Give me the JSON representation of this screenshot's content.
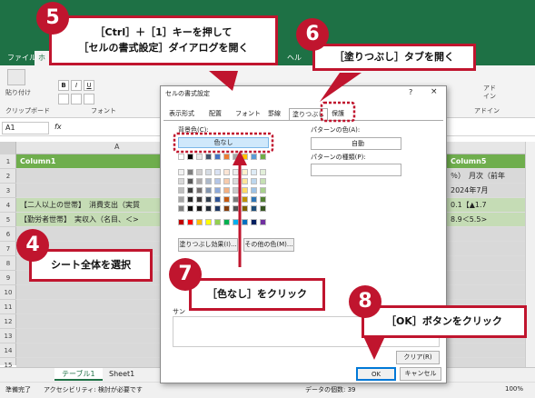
{
  "excel": {
    "tabs": [
      "ファイル",
      "ホ",
      "ヘル"
    ],
    "ribbon_labels": {
      "paste": "貼り付け",
      "clipboard": "クリップボード",
      "font": "フォント",
      "addin_top": "アド",
      "addin_mid": "イン",
      "addin": "アドイン",
      "bold": "B",
      "italic": "I",
      "underline": "U",
      "fx": "fx"
    },
    "name_box": "A1",
    "col_a": "A",
    "rows": [
      {
        "num": "1",
        "text": "Column1",
        "right": "Column5"
      },
      {
        "num": "2",
        "text": "",
        "right": "％）　月次（前年"
      },
      {
        "num": "3",
        "text": "",
        "right": "2024年7月"
      },
      {
        "num": "4",
        "text": "【二人以上の世帯】　消費支出（実質",
        "right": "0.1【▲1.7"
      },
      {
        "num": "5",
        "text": "【勤労者世帯】　実収入（名目、＜>",
        "right": "8.9＜5.5>"
      },
      {
        "num": "6",
        "text": "",
        "right": ""
      },
      {
        "num": "7",
        "text": "",
        "right": ""
      },
      {
        "num": "8",
        "text": "",
        "right": ""
      },
      {
        "num": "9",
        "text": "",
        "right": ""
      },
      {
        "num": "10",
        "text": "",
        "right": ""
      },
      {
        "num": "11",
        "text": "",
        "right": ""
      },
      {
        "num": "12",
        "text": "",
        "right": ""
      },
      {
        "num": "13",
        "text": "",
        "right": ""
      },
      {
        "num": "14",
        "text": "",
        "right": ""
      },
      {
        "num": "15",
        "text": "",
        "right": ""
      }
    ],
    "sheet_tabs": [
      "テーブル1",
      "Sheet1"
    ],
    "status": {
      "ready": "準備完了",
      "accessibility": "アクセシビリティ: 検討が必要です",
      "count": "データの個数: 39",
      "zoom": "100%"
    }
  },
  "dialog": {
    "title": "セルの書式設定",
    "help": "?",
    "close": "×",
    "tabs": [
      "表示形式",
      "配置",
      "フォント",
      "罫線",
      "塗りつぶし",
      "保護"
    ],
    "active_tab": "塗りつぶし",
    "bg_color_label": "背景色(C):",
    "no_color": "色なし",
    "fill_effects": "塗りつぶし効果(I)...",
    "more_colors": "その他の色(M)...",
    "pattern_color_label": "パターンの色(A):",
    "pattern_color_value": "自動",
    "pattern_style_label": "パターンの種類(P):",
    "pattern_style_value": "",
    "sample_label": "サン",
    "clear": "クリア(R)",
    "ok": "OK",
    "cancel": "キャンセル"
  },
  "palette": {
    "theme_top": [
      "#ffffff",
      "#000000",
      "#e7e6e6",
      "#44546a",
      "#4472c4",
      "#ed7d31",
      "#a5a5a5",
      "#ffc000",
      "#5b9bd5",
      "#70ad47"
    ],
    "theme_rows": [
      [
        "#f2f2f2",
        "#7f7f7f",
        "#d0cece",
        "#d6dce4",
        "#d9e2f3",
        "#fbe5d5",
        "#ededed",
        "#fff2cc",
        "#deebf6",
        "#e2efd9"
      ],
      [
        "#d8d8d8",
        "#595959",
        "#aeabab",
        "#adb9ca",
        "#b4c6e7",
        "#f7cbac",
        "#dbdbdb",
        "#fee599",
        "#bdd7ee",
        "#c5e0b3"
      ],
      [
        "#bfbfbf",
        "#3f3f3f",
        "#757070",
        "#8496b0",
        "#8eaadb",
        "#f4b183",
        "#c9c9c9",
        "#ffd965",
        "#9dc3e6",
        "#a8d08d"
      ],
      [
        "#a5a5a5",
        "#262626",
        "#3a3838",
        "#323f4f",
        "#2f5496",
        "#c55a11",
        "#7b7b7b",
        "#bf9000",
        "#2e75b5",
        "#538135"
      ],
      [
        "#7f7f7f",
        "#0c0c0c",
        "#171616",
        "#222a35",
        "#1e3763",
        "#833c0b",
        "#525252",
        "#7f6000",
        "#1e4e79",
        "#375623"
      ]
    ],
    "standard": [
      "#c00000",
      "#ff0000",
      "#ffc000",
      "#ffff00",
      "#92d050",
      "#00b050",
      "#00b0f0",
      "#0070c0",
      "#002060",
      "#7030a0"
    ]
  },
  "callouts": {
    "c4": {
      "num": "4",
      "text": "シート全体を選択"
    },
    "c5": {
      "num": "5",
      "line1": "［Ctrl］＋［1］キーを押して",
      "line2": "［セルの書式設定］ダイアログを開く"
    },
    "c6": {
      "num": "6",
      "text": "［塗りつぶし］タブを開く"
    },
    "c7": {
      "num": "7",
      "text": "［色なし］をクリック"
    },
    "c8": {
      "num": "8",
      "text": "［OK］ボタンをクリック"
    },
    "accent": "#c0152e"
  }
}
